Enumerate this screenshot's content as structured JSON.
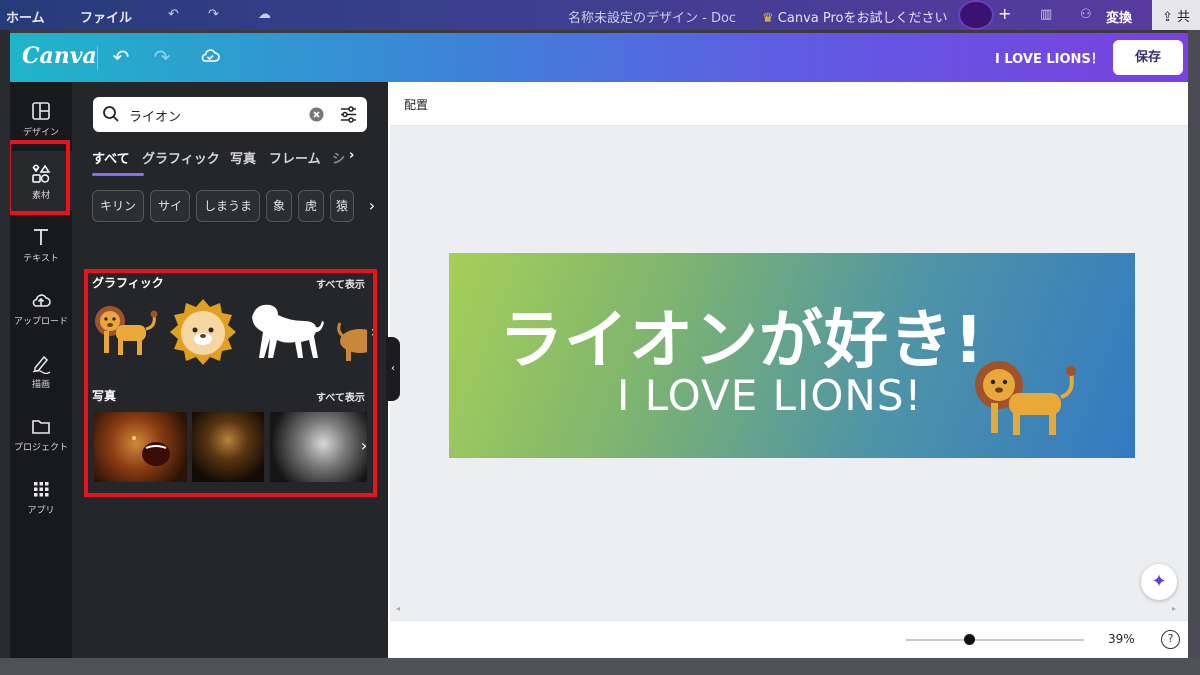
{
  "background_app": {
    "home": "ホーム",
    "file": "ファイル",
    "doc_title": "名称未設定のデザイン - Doc",
    "pro_offer": "Canva Proをお試しください",
    "convert": "変換",
    "share": "共"
  },
  "topbar": {
    "logo": "Canva",
    "design_title": "I LOVE LIONS！",
    "save_label": "保存"
  },
  "rail": {
    "items": [
      {
        "label": "デザイン",
        "icon": "layout-icon"
      },
      {
        "label": "素材",
        "icon": "elements-icon"
      },
      {
        "label": "テキスト",
        "icon": "text-icon"
      },
      {
        "label": "アップロード",
        "icon": "upload-icon"
      },
      {
        "label": "描画",
        "icon": "draw-icon"
      },
      {
        "label": "プロジェクト",
        "icon": "folder-icon"
      },
      {
        "label": "アプリ",
        "icon": "apps-icon"
      }
    ]
  },
  "panel": {
    "search_value": "ライオン",
    "tabs": [
      "すべて",
      "グラフィック",
      "写真",
      "フレーム"
    ],
    "chips": [
      "キリン",
      "サイ",
      "しまうま",
      "象",
      "虎",
      "猿"
    ],
    "graphics_title": "グラフィック",
    "photos_title": "写真",
    "see_all": "すべて表示"
  },
  "canvas": {
    "context_label": "配置",
    "design_jp": "ライオンが好き!",
    "design_en": "I LOVE LIONS!",
    "zoom": "39%",
    "zoom_fraction": 0.39,
    "help": "?"
  },
  "colors": {
    "accent": "#8b6cf1",
    "highlight_box": "#e6141c",
    "topbar_start": "#1fb5c9",
    "topbar_end": "#7a40e0"
  }
}
